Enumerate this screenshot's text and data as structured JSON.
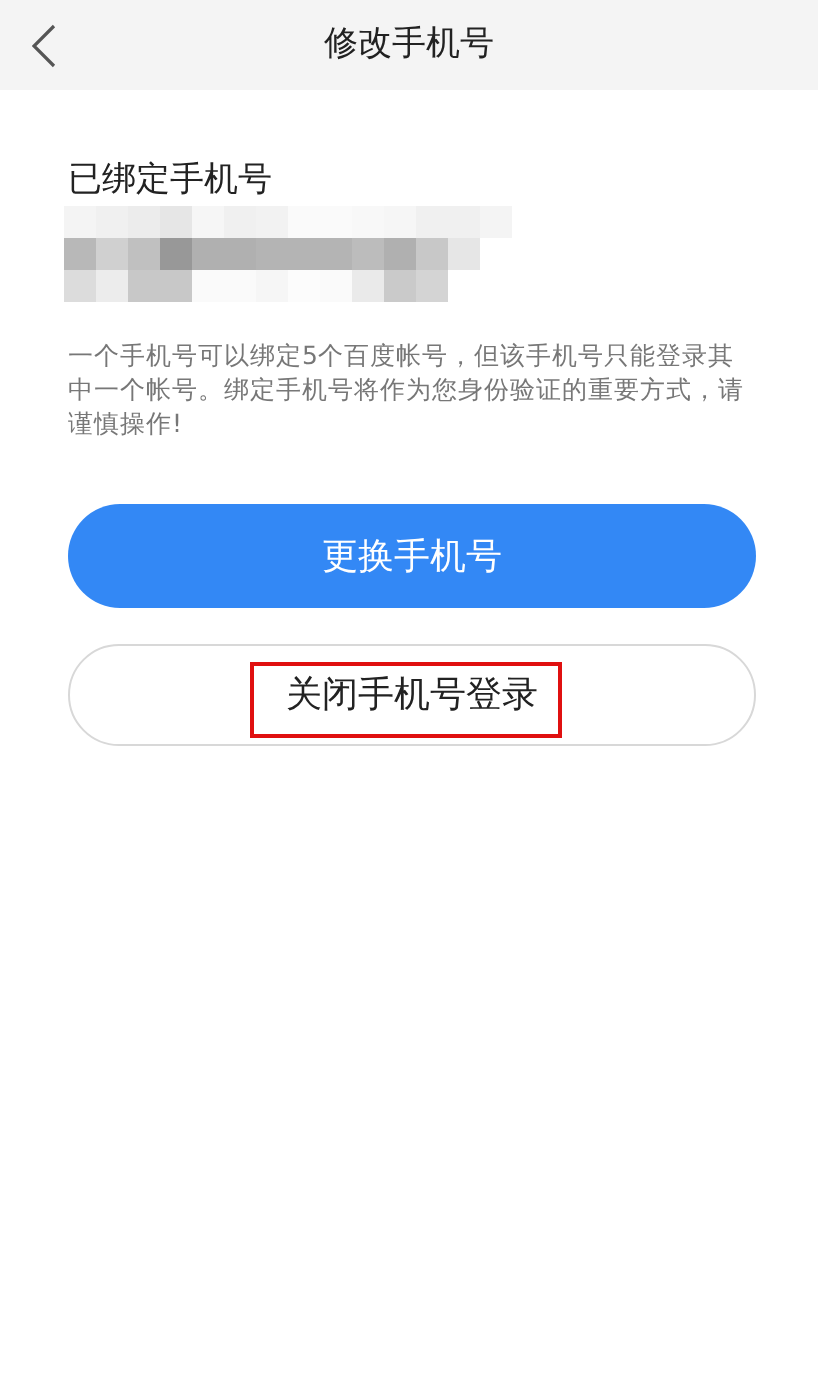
{
  "header": {
    "title": "修改手机号"
  },
  "bound": {
    "label": "已绑定手机号"
  },
  "notice": "一个手机号可以绑定5个百度帐号，但该手机号只能登录其中一个帐号。绑定手机号将作为您身份验证的重要方式，请谨慎操作!",
  "buttons": [
    {
      "kind": "primary",
      "label": "更换手机号",
      "highlighted": false
    },
    {
      "kind": "outline",
      "label": "关闭手机号登录",
      "highlighted": true
    }
  ]
}
